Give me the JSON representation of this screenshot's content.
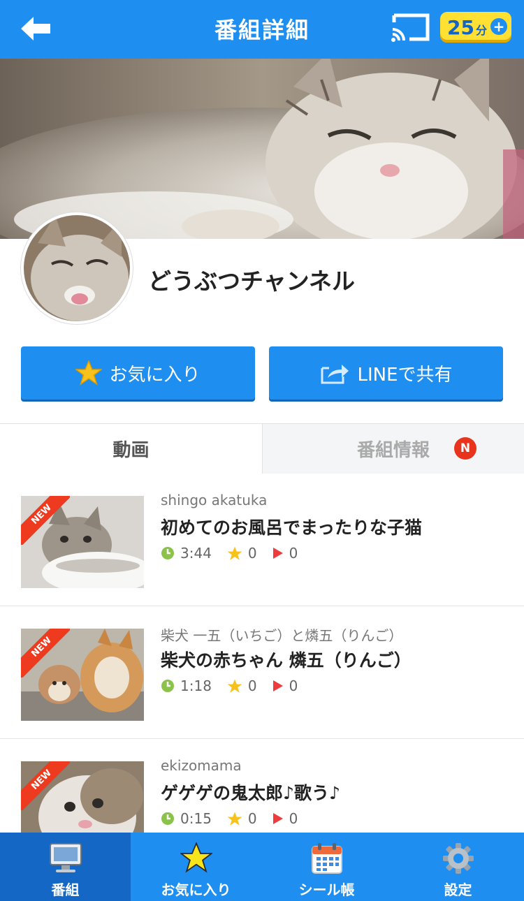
{
  "header": {
    "title": "番組詳細",
    "back_icon": "back-arrow-icon",
    "cast_icon": "cast-icon",
    "minutes_value": "25",
    "minutes_unit": "分",
    "minutes_plus": "+"
  },
  "channel": {
    "name": "どうぶつチャンネル"
  },
  "actions": {
    "favorite_label": "お気に入り",
    "share_label": "LINEで共有"
  },
  "tabs": [
    {
      "label": "動画",
      "active": true
    },
    {
      "label": "番組情報",
      "active": false,
      "badge": "N"
    }
  ],
  "videos": [
    {
      "author": "shingo akatuka",
      "title": "初めてのお風呂でまったりな子猫",
      "duration": "3:44",
      "favorites": "0",
      "plays": "0",
      "new": "NEW"
    },
    {
      "author": "柴犬 一五（いちご）と燐五（りんご）",
      "title": "柴犬の赤ちゃん 燐五（りんご）",
      "duration": "1:18",
      "favorites": "0",
      "plays": "0",
      "new": "NEW"
    },
    {
      "author": "ekizomama",
      "title": "ゲゲゲの鬼太郎♪歌う♪",
      "duration": "0:15",
      "favorites": "0",
      "plays": "0",
      "new": "NEW"
    }
  ],
  "bottom_nav": [
    {
      "label": "番組",
      "icon": "monitor-icon",
      "active": true
    },
    {
      "label": "お気に入り",
      "icon": "star-icon",
      "active": false
    },
    {
      "label": "シール帳",
      "icon": "calendar-icon",
      "active": false
    },
    {
      "label": "設定",
      "icon": "gear-icon",
      "active": false
    }
  ],
  "colors": {
    "primary": "#1e8ef0",
    "nav_active": "#1467c4",
    "badge_red": "#e8341c",
    "star_yellow": "#f7c21c",
    "clock_green": "#8bc34a",
    "play_red": "#ee3b3b"
  }
}
